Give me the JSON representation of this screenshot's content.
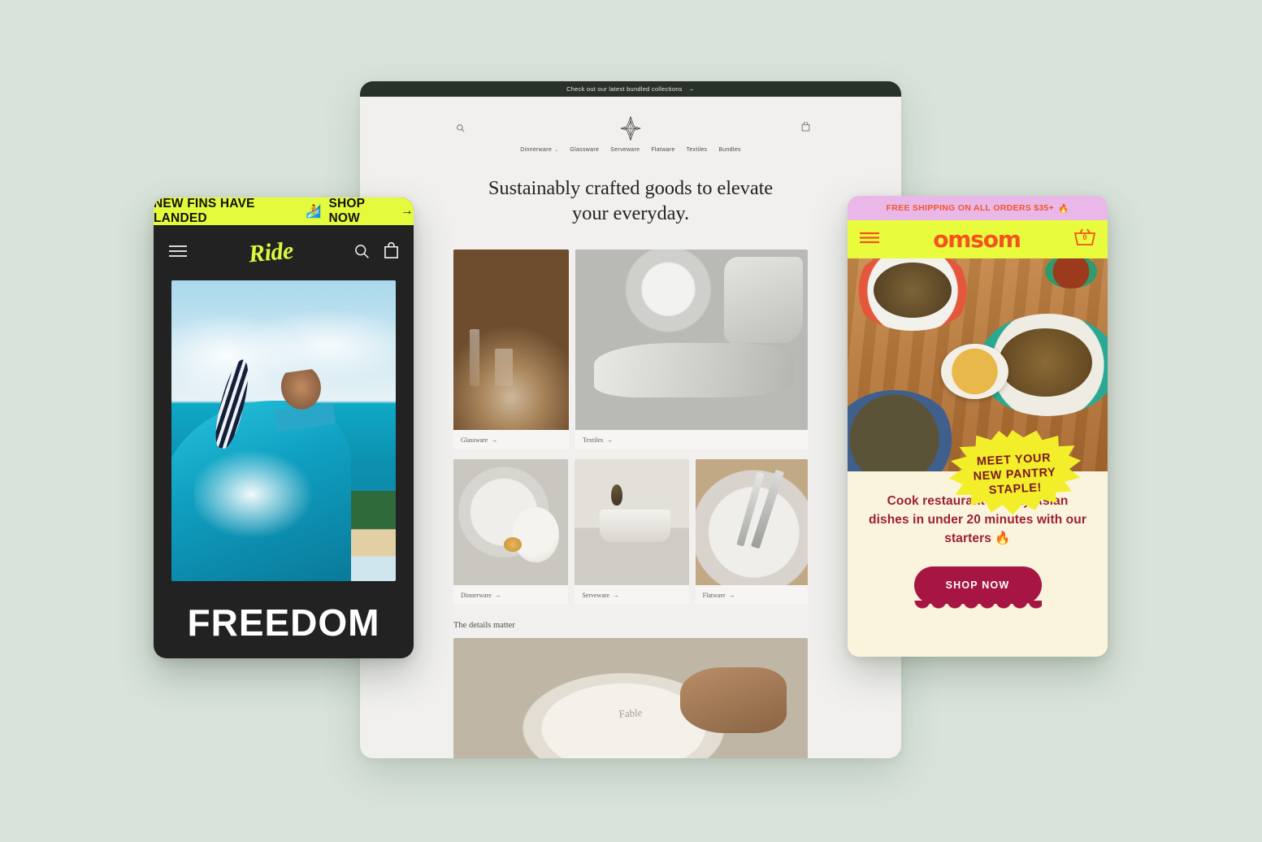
{
  "canvas": {
    "background": "#d9e3da"
  },
  "tablet": {
    "name": "fable-storefront",
    "announcement": {
      "text": "Check out our latest bundled collections",
      "arrow": "→",
      "bg": "#293128",
      "fg": "#e8e9e4"
    },
    "header": {
      "search_icon": "search-icon",
      "logo_icon": "sparkle-star-logo",
      "cart_icon": "cart-icon"
    },
    "nav": [
      {
        "label": "Dinnerware",
        "caret": "⌄"
      },
      {
        "label": "Glassware",
        "caret": ""
      },
      {
        "label": "Serveware",
        "caret": ""
      },
      {
        "label": "Flatware",
        "caret": ""
      },
      {
        "label": "Textiles",
        "caret": ""
      },
      {
        "label": "Bundles",
        "caret": ""
      }
    ],
    "hero": {
      "line1": "Sustainably crafted goods to elevate",
      "line2": "your everyday."
    },
    "collections_row1": [
      {
        "label": "Glassware",
        "arrow": "→"
      },
      {
        "label": "Textiles",
        "arrow": "→"
      }
    ],
    "collections_row2": [
      {
        "label": "Dinnerware",
        "arrow": "→"
      },
      {
        "label": "Serveware",
        "arrow": "→"
      },
      {
        "label": "Flatware",
        "arrow": "→"
      }
    ],
    "details_heading": "The details matter",
    "plate_emboss": "Fable"
  },
  "ride": {
    "name": "ride-storefront",
    "announcement": {
      "text": "NEW FINS HAVE LANDED",
      "emoji": "🏄",
      "cta": "SHOP NOW",
      "arrow": "→",
      "bg": "#e3fb3c",
      "fg": "#111111"
    },
    "header": {
      "menu_icon": "hamburger-menu-icon",
      "logo": "Ride",
      "search_icon": "search-icon",
      "cart_icon": "cart-icon",
      "bg": "#222222",
      "logo_color": "#dcf93c"
    },
    "hero_heading": "FREEDOM"
  },
  "omsom": {
    "name": "omsom-storefront",
    "announcement": {
      "text": "FREE SHIPPING ON ALL ORDERS $35+",
      "emoji": "🔥",
      "bg": "#e9b8e8",
      "fg": "#f2562b"
    },
    "header": {
      "menu_icon": "hamburger-menu-icon",
      "logo": "omsom",
      "cart_icon": "shopping-basket-icon",
      "cart_count": "0",
      "bg": "#e8fb3c",
      "logo_color": "#f4521f"
    },
    "badge": {
      "line1": "MEET YOUR",
      "line2": "NEW PANTRY",
      "line3": "STAPLE!",
      "fill": "#f2ef2a",
      "outline": "#f4521f",
      "text_color": "#7a1528"
    },
    "copy": "Cook restaurant-quality Asian dishes in under 20 minutes with our starters 🔥",
    "cta": {
      "label": "SHOP NOW",
      "bg": "#a61543",
      "fg": "#ffffff"
    },
    "panel_bg": "#fbf4dd"
  }
}
